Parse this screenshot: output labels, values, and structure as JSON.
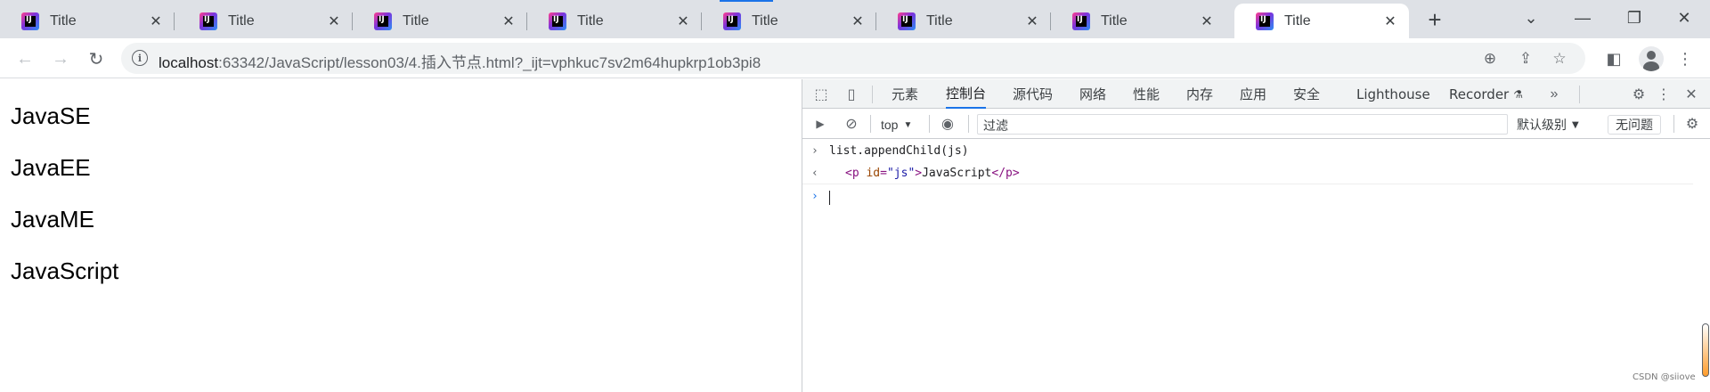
{
  "browser": {
    "tabs": [
      {
        "title": "Title",
        "active": false
      },
      {
        "title": "Title",
        "active": false
      },
      {
        "title": "Title",
        "active": false
      },
      {
        "title": "Title",
        "active": false
      },
      {
        "title": "Title",
        "active": false
      },
      {
        "title": "Title",
        "active": false
      },
      {
        "title": "Title",
        "active": false
      },
      {
        "title": "Title",
        "active": true
      }
    ],
    "favicon_text": "IJ",
    "close_glyph": "✕",
    "new_tab_glyph": "+",
    "window_controls": {
      "tab_search": "⌄",
      "minimize": "—",
      "maximize": "❐",
      "close": "✕"
    },
    "nav": {
      "back": "←",
      "forward": "→",
      "reload": "↻"
    },
    "address": {
      "info_icon": "i",
      "host": "localhost",
      "rest": ":63342/JavaScript/lesson03/4.插入节点.html?_ijt=vphkuc7sv2m64hupkrp1ob3pi8"
    },
    "toolbar_icons": {
      "zoom": "⊕",
      "share": "⇪",
      "bookmark": "☆",
      "sidepanel": "◧",
      "menu": "⋮"
    }
  },
  "page": {
    "paragraphs": [
      "JavaSE",
      "JavaEE",
      "JavaME",
      "JavaScript"
    ]
  },
  "devtools": {
    "icons": {
      "inspect": "⬚",
      "device": "▯",
      "more_tabs": "»",
      "settings": "⚙",
      "kebab": "⋮",
      "close": "✕"
    },
    "tabs": [
      {
        "label": "元素",
        "active": false
      },
      {
        "label": "控制台",
        "active": true
      },
      {
        "label": "源代码",
        "active": false
      },
      {
        "label": "网络",
        "active": false
      },
      {
        "label": "性能",
        "active": false
      },
      {
        "label": "内存",
        "active": false
      },
      {
        "label": "应用",
        "active": false
      },
      {
        "label": "安全",
        "active": false
      },
      {
        "label": "Lighthouse",
        "active": false
      },
      {
        "label": "Recorder",
        "active": false
      }
    ],
    "recorder_badge": "⚗",
    "console_bar": {
      "sidebar_icon": "▶",
      "clear_icon": "⊘",
      "context": "top",
      "dropdown_arrow": "▼",
      "eye_icon": "◉",
      "filter_placeholder": "过滤",
      "level": "默认级别",
      "issues": "无问题",
      "settings_icon": "⚙"
    },
    "console": {
      "input_marker": "›",
      "output_marker": "‹",
      "command": "list.appendChild(js)",
      "result": {
        "open_lt": "<",
        "tag": "p",
        "attr_name": "id",
        "eq": "=",
        "attr_value": "\"js\"",
        "close_gt": ">",
        "text": "JavaScript",
        "close_tag_open": "</",
        "close_tag_end": ">"
      },
      "prompt_marker": "›"
    }
  },
  "watermark": "CSDN @siiove"
}
